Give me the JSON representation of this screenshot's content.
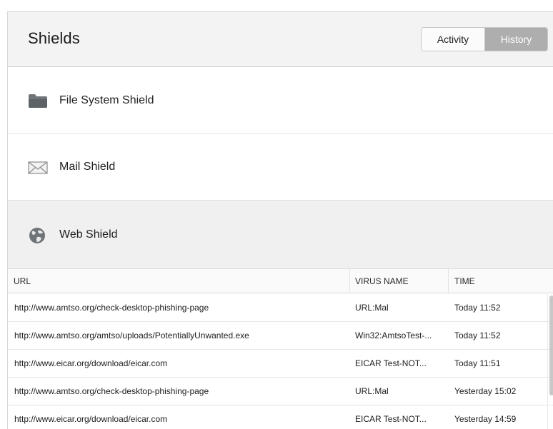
{
  "header": {
    "title": "Shields",
    "tabs": [
      {
        "label": "Activity",
        "selected": false
      },
      {
        "label": "History",
        "selected": true
      }
    ]
  },
  "shields": [
    {
      "label": "File System Shield",
      "icon": "folder-icon"
    },
    {
      "label": "Mail Shield",
      "icon": "envelope-icon"
    },
    {
      "label": "Web Shield",
      "icon": "globe-icon",
      "selected": true
    }
  ],
  "table": {
    "columns": {
      "url": "URL",
      "virus": "VIRUS NAME",
      "time": "TIME"
    },
    "rows": [
      {
        "url": "http://www.amtso.org/check-desktop-phishing-page",
        "virus": "URL:Mal",
        "time": "Today 11:52"
      },
      {
        "url": "http://www.amtso.org/amtso/uploads/PotentiallyUnwanted.exe",
        "virus": "Win32:AmtsoTest-...",
        "time": "Today 11:52"
      },
      {
        "url": "http://www.eicar.org/download/eicar.com",
        "virus": "EICAR Test-NOT...",
        "time": "Today 11:51"
      },
      {
        "url": "http://www.amtso.org/check-desktop-phishing-page",
        "virus": "URL:Mal",
        "time": "Yesterday 15:02"
      },
      {
        "url": "http://www.eicar.org/download/eicar.com",
        "virus": "EICAR Test-NOT...",
        "time": "Yesterday 14:59"
      }
    ]
  },
  "colors": {
    "header_bg": "#f3f3f3",
    "selected_tab_bg": "#aeaeae",
    "selected_row_bg": "#f0f0f0"
  }
}
